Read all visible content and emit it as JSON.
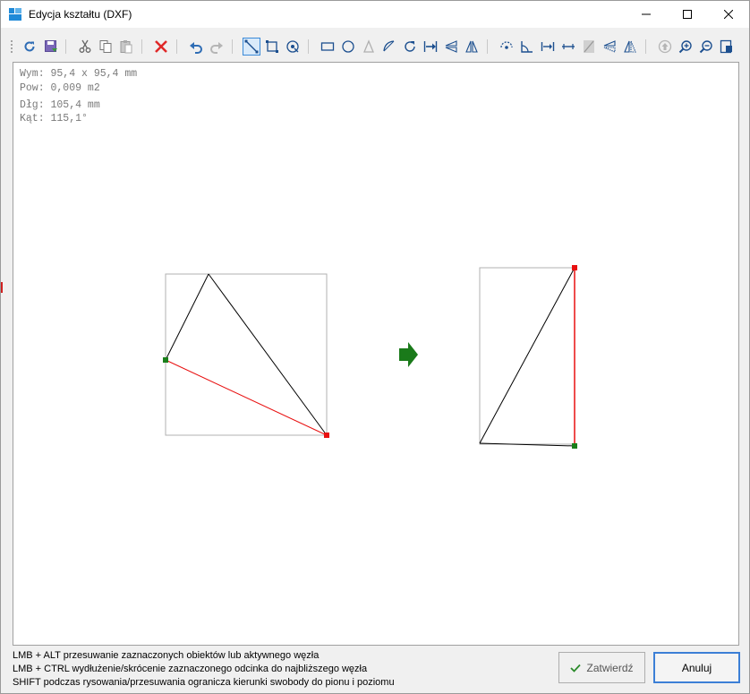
{
  "window": {
    "title": "Edycja kształtu (DXF)",
    "controls": [
      "minimize",
      "maximize",
      "close"
    ]
  },
  "toolbar": {
    "groups": [
      [
        "refresh-icon",
        "save-icon"
      ],
      [
        "cut-icon",
        "copy-icon",
        "paste-icon"
      ],
      [
        "delete-icon"
      ],
      [
        "undo-icon",
        "redo-icon"
      ],
      [
        "select-line-icon",
        "select-rect-icon",
        "select-node-icon"
      ],
      [
        "rectangle-icon",
        "circle-icon",
        "triangle-icon",
        "arc-icon",
        "rotate-icon",
        "move-to-edge-icon",
        "mirror-horizontal-icon",
        "mirror-vertical-icon"
      ],
      [
        "rotate-node-icon",
        "angle-icon",
        "distance-icon",
        "extend-icon",
        "cross-icon",
        "mirror-h2-icon",
        "mirror-v2-icon"
      ],
      [
        "up-icon",
        "zoom-in-icon",
        "zoom-out-icon",
        "fit-icon"
      ]
    ],
    "active": "select-line-icon"
  },
  "info": {
    "dimensions": "Wym: 95,4 x 95,4 mm",
    "area": "Pow: 0,009 m2",
    "length": "Dłg: 105,4 mm",
    "angle": "Kąt: 115,1°"
  },
  "colors": {
    "selected_segment": "#e81010",
    "start_node": "#1a7f1a",
    "end_node": "#e81010",
    "arrow": "#1a7a1a",
    "bounding_box": "#b0b0b0"
  },
  "hints": [
    "LMB + ALT przesuwanie zaznaczonych obiektów lub aktywnego węzła",
    "LMB + CTRL wydłużenie/skrócenie zaznaczonego odcinka do najbliższego węzła",
    "SHIFT podczas rysowania/przesuwania ogranicza kierunki swobody do pionu i poziomu"
  ],
  "buttons": {
    "confirm": "Zatwierdź",
    "cancel": "Anuluj"
  }
}
